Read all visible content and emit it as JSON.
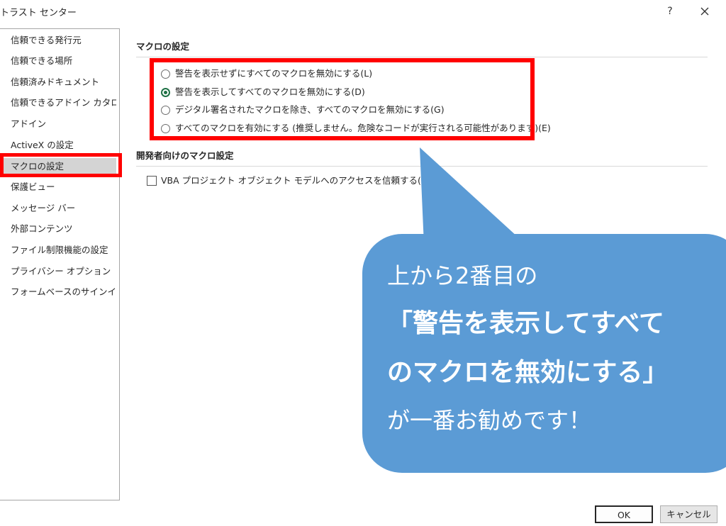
{
  "window": {
    "title": "トラスト センター",
    "help_label": "?"
  },
  "sidebar": {
    "items": [
      {
        "label": "信頼できる発行元"
      },
      {
        "label": "信頼できる場所"
      },
      {
        "label": "信頼済みドキュメント"
      },
      {
        "label": "信頼できるアドイン カタログ"
      },
      {
        "label": "アドイン"
      },
      {
        "label": "ActiveX の設定"
      },
      {
        "label": "マクロの設定",
        "selected": true
      },
      {
        "label": "保護ビュー"
      },
      {
        "label": "メッセージ バー"
      },
      {
        "label": "外部コンテンツ"
      },
      {
        "label": "ファイル制限機能の設定"
      },
      {
        "label": "プライバシー オプション"
      },
      {
        "label": "フォームベースのサインイン"
      }
    ]
  },
  "macro_settings": {
    "title": "マクロの設定",
    "options": [
      {
        "label": "警告を表示せずにすべてのマクロを無効にする(L)",
        "checked": false
      },
      {
        "label": "警告を表示してすべてのマクロを無効にする(D)",
        "checked": true
      },
      {
        "label": "デジタル署名されたマクロを除き、すべてのマクロを無効にする(G)",
        "checked": false
      },
      {
        "label": "すべてのマクロを有効にする (推奨しません。危険なコードが実行される可能性があります)(E)",
        "checked": false
      }
    ]
  },
  "developer_settings": {
    "title": "開発者向けのマクロ設定",
    "vba_access_label": "VBA プロジェクト オブジェクト モデルへのアクセスを信頼する(V)",
    "vba_access_checked": false
  },
  "callout": {
    "line1": "上から2番目の",
    "line2": "「警告を表示してすべて",
    "line3": "のマクロを無効にする」",
    "line4": "が一番お勧めです！",
    "color": "#5b9bd5"
  },
  "footer": {
    "ok_label": "OK",
    "cancel_label": "キャンセル"
  },
  "colors": {
    "highlight": "#ff0000",
    "radio_checked": "#1e7145"
  }
}
